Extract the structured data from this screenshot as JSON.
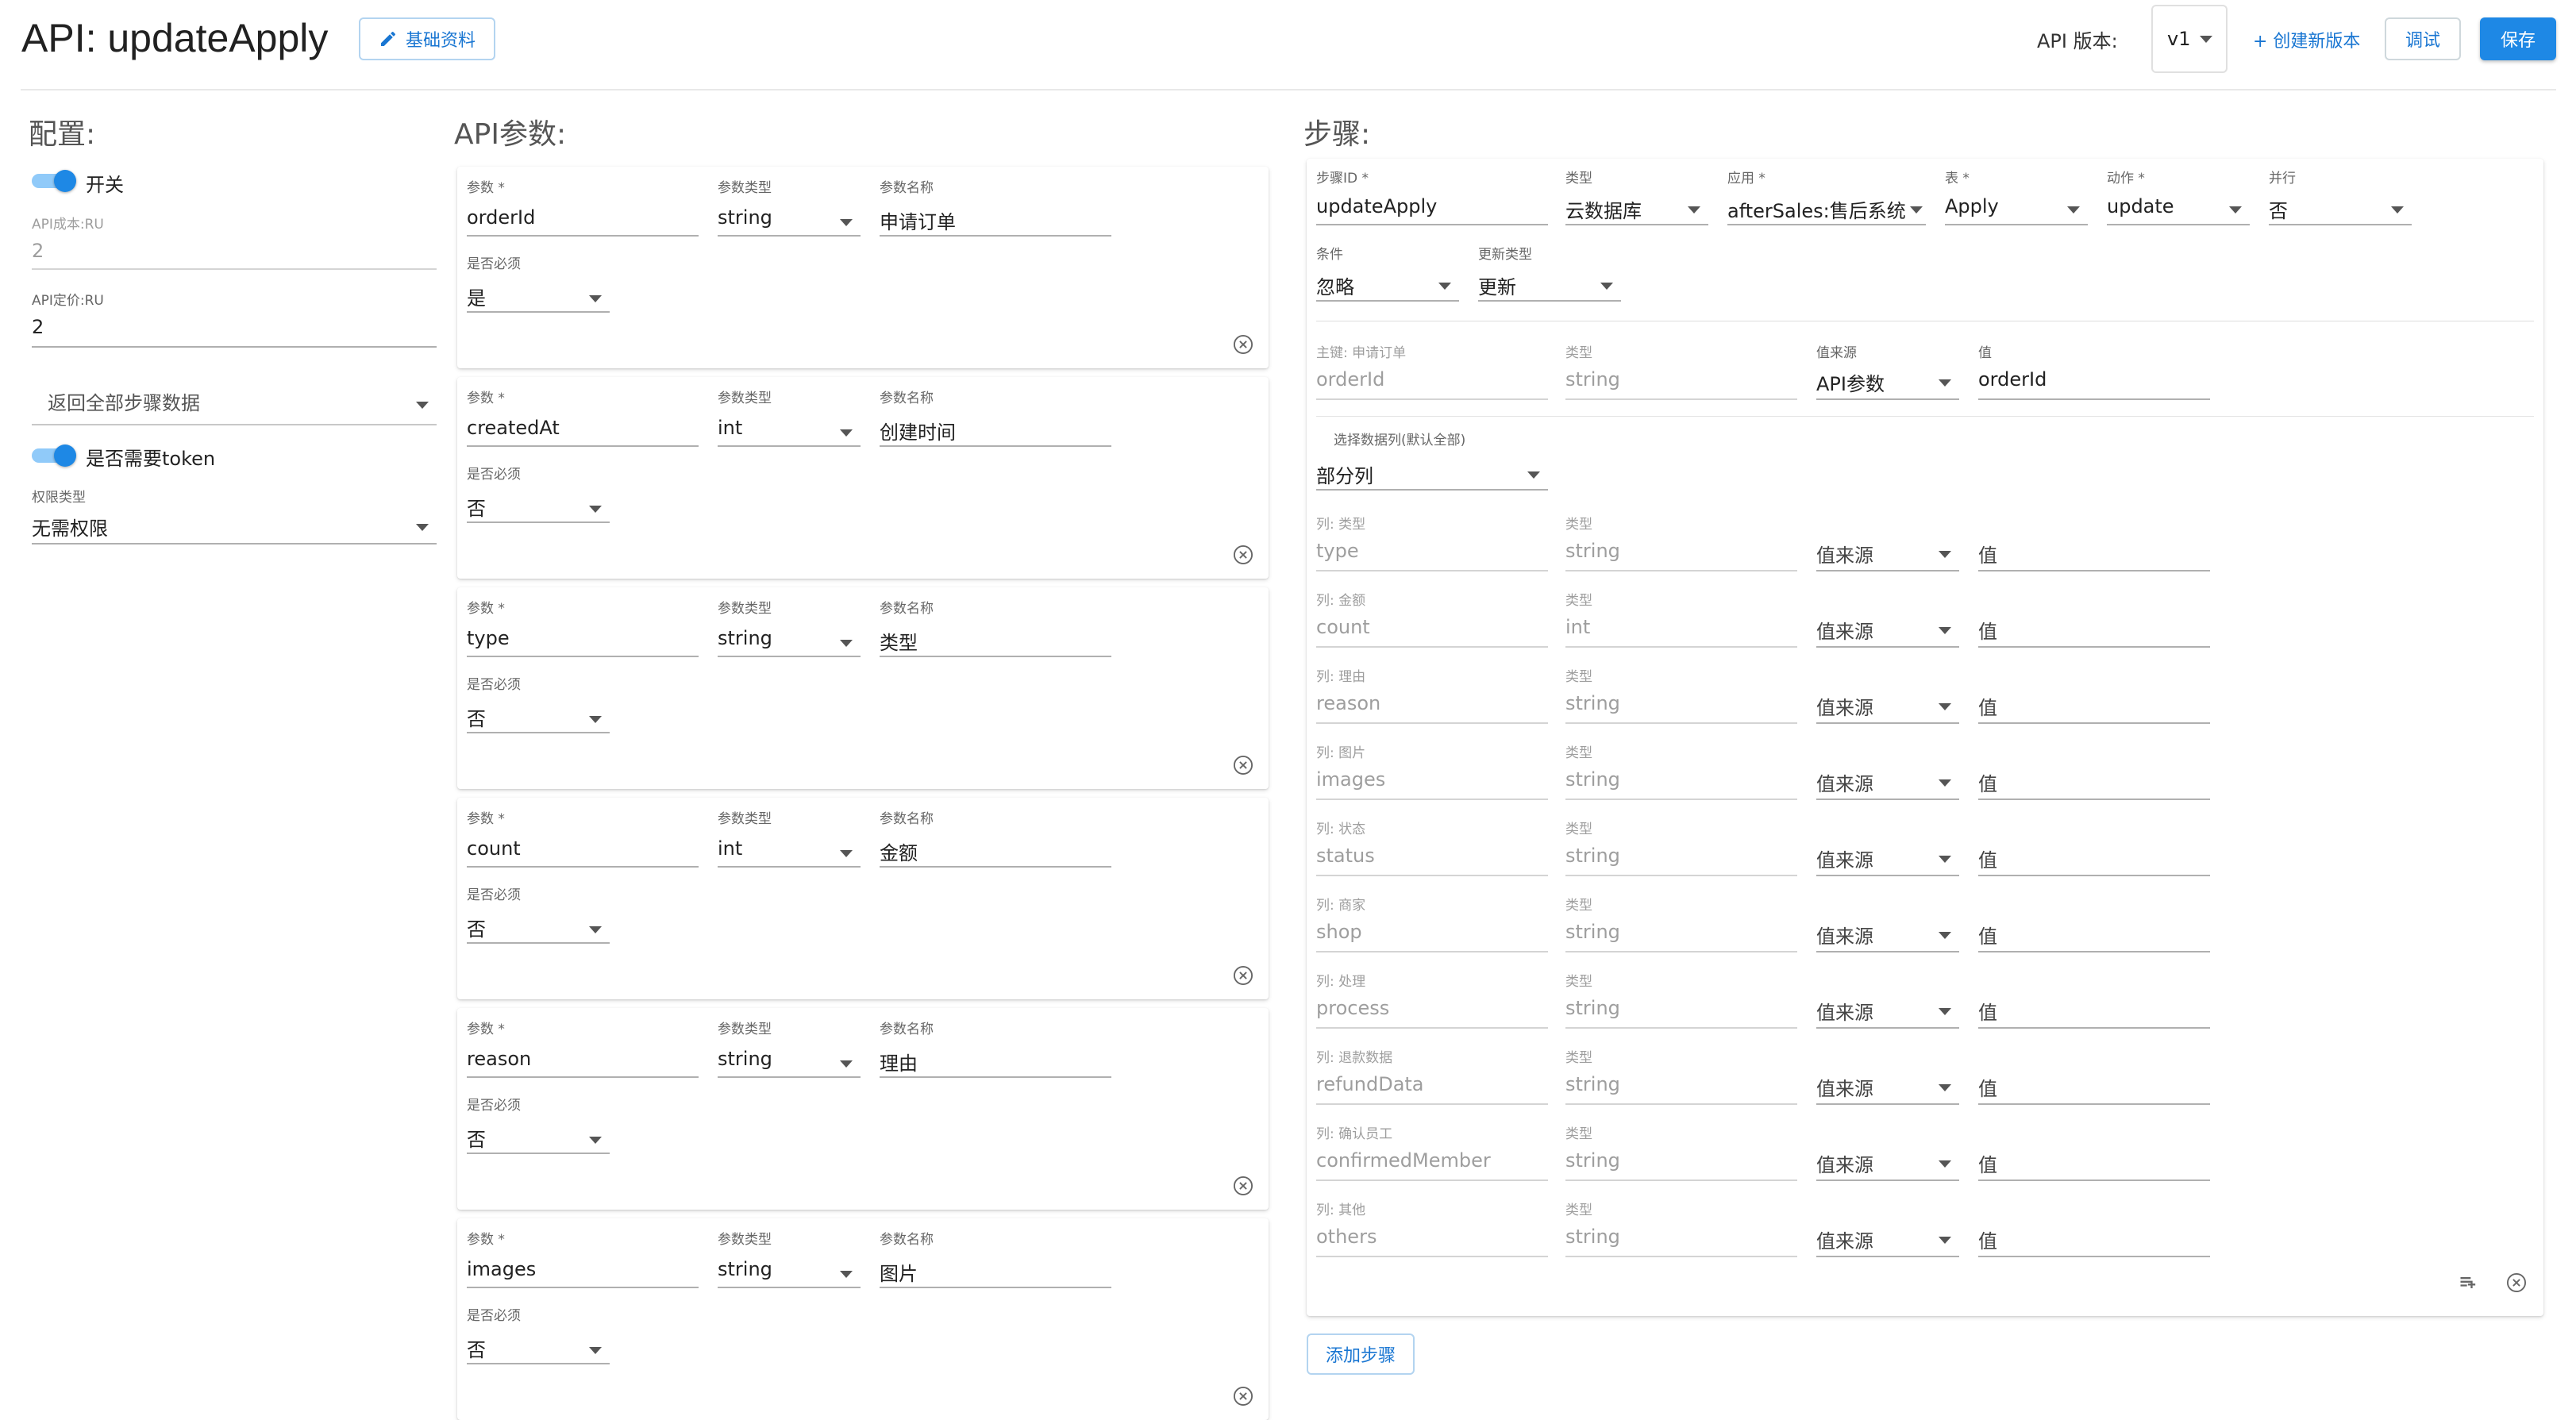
{
  "header": {
    "title": "API: updateApply",
    "basic_info_label": "基础资料",
    "version_label": "API 版本:",
    "version_value": "v1",
    "create_version_label": "+ 创建新版本",
    "debug_label": "调试",
    "save_label": "保存"
  },
  "config": {
    "title": "配置:",
    "switch_label": "开关",
    "api_cost_label": "API成本:RU",
    "api_cost_value": "2",
    "api_price_label": "API定价:RU",
    "api_price_value": "2",
    "return_select": "返回全部步骤数据",
    "token_label": "是否需要token",
    "auth_type_label": "权限类型",
    "auth_type_value": "无需权限"
  },
  "api_params": {
    "title": "API参数:",
    "labels": {
      "param": "参数 *",
      "param_type": "参数类型",
      "param_name": "参数名称",
      "required": "是否必须"
    },
    "items": [
      {
        "param": "orderId",
        "type": "string",
        "name": "申请订单",
        "required": "是"
      },
      {
        "param": "createdAt",
        "type": "int",
        "name": "创建时间",
        "required": "否"
      },
      {
        "param": "type",
        "type": "string",
        "name": "类型",
        "required": "否"
      },
      {
        "param": "count",
        "type": "int",
        "name": "金额",
        "required": "否"
      },
      {
        "param": "reason",
        "type": "string",
        "name": "理由",
        "required": "否"
      },
      {
        "param": "images",
        "type": "string",
        "name": "图片",
        "required": "否"
      }
    ]
  },
  "steps": {
    "title": "步骤:",
    "row1": {
      "step_id_label": "步骤ID *",
      "step_id": "updateApply",
      "type_label": "类型",
      "type": "云数据库",
      "app_label": "应用 *",
      "app": "afterSales:售后系统",
      "table_label": "表 *",
      "table": "Apply",
      "action_label": "动作 *",
      "action": "update",
      "parallel_label": "并行",
      "parallel": "否"
    },
    "row2": {
      "condition_label": "条件",
      "condition": "忽略",
      "update_type_label": "更新类型",
      "update_type": "更新"
    },
    "pk": {
      "label": "主键: 申请订单",
      "value": "orderId",
      "type_label": "类型",
      "type": "string",
      "source_label": "值来源",
      "source": "API参数",
      "value_label": "值",
      "value_val": "orderId"
    },
    "select_cols_label": "选择数据列(默认全部)",
    "select_cols_value": "部分列",
    "col_type_label": "类型",
    "source_placeholder": "值来源",
    "value_placeholder": "值",
    "columns": [
      {
        "label": "列: 类型",
        "name": "type",
        "type": "string"
      },
      {
        "label": "列: 金额",
        "name": "count",
        "type": "int"
      },
      {
        "label": "列: 理由",
        "name": "reason",
        "type": "string"
      },
      {
        "label": "列: 图片",
        "name": "images",
        "type": "string"
      },
      {
        "label": "列: 状态",
        "name": "status",
        "type": "string"
      },
      {
        "label": "列: 商家",
        "name": "shop",
        "type": "string"
      },
      {
        "label": "列: 处理",
        "name": "process",
        "type": "string"
      },
      {
        "label": "列: 退款数据",
        "name": "refundData",
        "type": "string"
      },
      {
        "label": "列: 确认员工",
        "name": "confirmedMember",
        "type": "string"
      },
      {
        "label": "列: 其他",
        "name": "others",
        "type": "string"
      }
    ],
    "add_step_label": "添加步骤"
  },
  "icons": {
    "edit": "pencil-icon",
    "remove": "close-circle-icon",
    "add_list": "playlist-add-icon"
  },
  "colors": {
    "primary": "#1e88e5",
    "toggle_track": "#90caf9"
  }
}
